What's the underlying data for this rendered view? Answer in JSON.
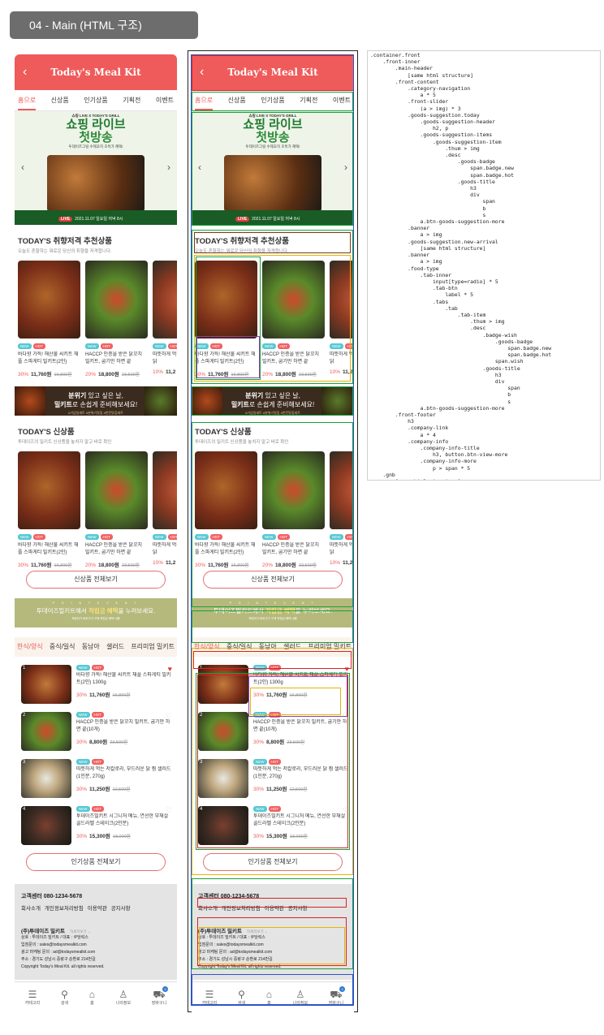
{
  "section_label": "04 - Main (HTML 구조)",
  "header": {
    "title": "Today's Meal Kit",
    "back": "‹"
  },
  "category_nav": [
    "홈으로",
    "신상품",
    "인기상품",
    "기획전",
    "이벤트"
  ],
  "slider": {
    "brand": "쇼핑 LIVE X TODAY'S GRILL",
    "title1": "쇼핑 라이브",
    "title2": "첫방송",
    "sub": "투데이즈그릴 수제꼬치 초특가 혜택!",
    "live": "LIVE",
    "date": "2021.11.07 일요일 저녁 8시"
  },
  "today": {
    "title": "TODAY'S 취향저격 추천상품",
    "desc": "오늘도 흔할하는 뭐로운 당신의 취향을 저격합니다."
  },
  "products": [
    {
      "title": "바다향 가득! 해산물 씨키트 채플 스파게티 밀키트(2인)",
      "discount": "30%",
      "price": "11,760원",
      "orig": "16,800원"
    },
    {
      "title": "HACCP 인증을 받은 닭꼬치 밀키트, 굽기만 하면 끝",
      "discount": "20%",
      "price": "18,800원",
      "orig": "23,500원"
    },
    {
      "title": "따뜻하게 먹는 저칼로리 드레싱 닭",
      "discount": "10%",
      "price": "11,2",
      "orig": ""
    }
  ],
  "badges": {
    "new": "NEW",
    "hot": "HOT"
  },
  "banner": {
    "pre": "분위기",
    "m1": " 있고 싶은 날,",
    "hl": "밀키트",
    "m2": "로 손쉽게 준비해보세요!",
    "sub": "#기념일세트 #분위기맛집 #반칸맛집세트"
  },
  "new_arrival": {
    "title": "TODAY'S 신상품",
    "desc": "투데이즈의 밀키트 신상품을 놓치지 말고 바로 확인",
    "more": "신상품 전체보기"
  },
  "event": {
    "label": "P O I N T  E V E N T",
    "m1": "투데이즈밀키트에서 ",
    "hl": "적립금 혜택",
    "m2": "을 누려보세요.",
    "sub": "적립하기 바로가기 구매 적립금 혜택 내용"
  },
  "food_tabs": [
    "한식/양식",
    "중식/일식",
    "동남아",
    "샐러드",
    "프리미엄 밀키트"
  ],
  "tab_items": [
    {
      "title": "바다향 가득! 해산물 씨키트 채플 스파게티 밀키트(2인) 1300g",
      "discount": "30%",
      "price": "11,760원",
      "orig": "16,800원",
      "wish": true
    },
    {
      "title": "HACCP 인증을 받은 닭꼬치 밀키트, 굽기만 하면 끝(10개)",
      "discount": "30%",
      "price": "8,800원",
      "orig": "23,500원",
      "wish": false
    },
    {
      "title": "따뜻하게 먹는 저칼로리, 부드러운 닭 찜 샐러드(1인분, 270g)",
      "discount": "30%",
      "price": "11,250원",
      "orig": "12,500원",
      "wish": false
    },
    {
      "title": "투데이즈밀키트 시그니처 메뉴, 연선한 부채살 골드라벨 스테이크(2인분)",
      "discount": "30%",
      "price": "15,300원",
      "orig": "18,000원",
      "wish": false
    }
  ],
  "popular_more": "인기상품 전체보기",
  "footer": {
    "cs": "고객센터  080-1234-5678",
    "links": [
      "회사소개",
      "개인정보처리방침",
      "이용약관",
      "공지사항"
    ],
    "company": "(주)투데이즈 밀키트",
    "more": "자세히보기 ⌄",
    "lines": [
      "상호 : 투데이즈 밀키트 / 대표 : 쿠당릭스",
      "입점문의 : sales@todaysmealkit.com",
      "광고 마케팅 문의 : ad@todaysmealkit.com",
      "주소 : 경기도 성남시 중랑구 순환로 214번길",
      "Copyright Today's Meal Kit. all rights reserved."
    ]
  },
  "gnb": [
    {
      "label": "카테고리",
      "icon": "menu-icon"
    },
    {
      "label": "검색",
      "icon": "search-icon"
    },
    {
      "label": "홈",
      "icon": "home-icon"
    },
    {
      "label": "나의정보",
      "icon": "user-icon"
    },
    {
      "label": "장바구니",
      "icon": "cart-icon",
      "count": "0"
    }
  ],
  "code_tree": ".container.front\n    .front-inner\n        .main-header\n            [same html structure]\n        .front-content\n            .category-navigation\n                a * 5\n            .front-slider\n                (a > img) * 3\n            .goods-suggestion.today\n                .goods-suggestion-header\n                    h2, p\n                .goods-suggestion-items\n                    .goods-suggestion-item\n                        .thum > img\n                        .desc\n                            .goods-badge\n                                span.badge.new\n                                span.badge.hot\n                            .goods-title\n                                h3\n                                div\n                                    span\n                                    b\n                                    s\n                a.btn-goods-suggestion-more\n            .banner\n                a > img\n            .goods-suggestion.new-arrival\n                [same html structure]\n            .banner\n                a > img\n            .food-type\n                .tab-inner\n                    input[type=radio] * 5\n                    .tab-btn\n                        label * 5\n                    .tabs\n                        .tab\n                            .tab-item\n                                .thum > img\n                                .desc\n                                    .badge-wish\n                                        .goods-badge\n                                            span.badge.new\n                                            span.badge.hot\n                                        span.wish\n                                    .goods-title\n                                        h3\n                                        div\n                                            span\n                                            b\n                                            s\n                a.btn-goods-suggestion-more\n        .front-footer\n            h3\n            .company-link\n                a * 4\n            .company-info\n                .company-info-title\n                    h3, button.btn-view-more\n                .company-info-more\n                    p > span * 5\n    .gnb\n        [same html structure]"
}
